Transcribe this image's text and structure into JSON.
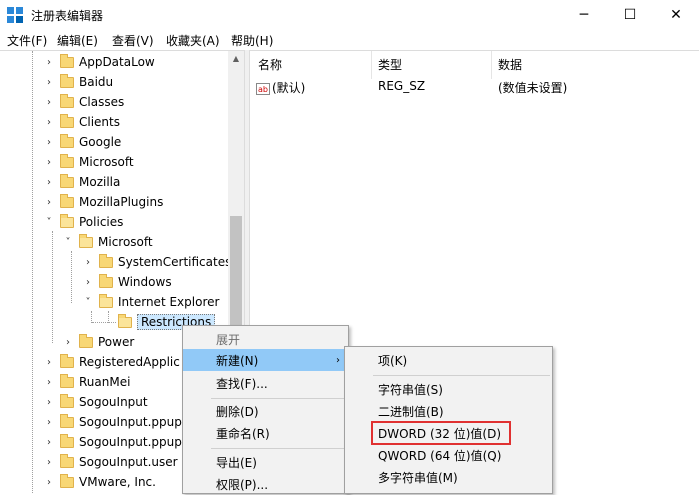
{
  "window": {
    "title": "注册表编辑器",
    "minimize": "─",
    "maximize": "☐",
    "close": "✕"
  },
  "menubar": [
    "文件(F)",
    "编辑(E)",
    "查看(V)",
    "收藏夹(A)",
    "帮助(H)"
  ],
  "tree": [
    {
      "label": "AppDataLow",
      "chevron": "›"
    },
    {
      "label": "Baidu",
      "chevron": "›"
    },
    {
      "label": "Classes",
      "chevron": "›"
    },
    {
      "label": "Clients",
      "chevron": "›"
    },
    {
      "label": "Google",
      "chevron": "›"
    },
    {
      "label": "Microsoft",
      "chevron": "›"
    },
    {
      "label": "Mozilla",
      "chevron": "›"
    },
    {
      "label": "MozillaPlugins",
      "chevron": "›"
    },
    {
      "label": "Policies",
      "chevron": "˅"
    },
    {
      "label": "Microsoft",
      "chevron": "˅"
    },
    {
      "label": "SystemCertificates",
      "chevron": "›"
    },
    {
      "label": "Windows",
      "chevron": "›"
    },
    {
      "label": "Internet Explorer",
      "chevron": "˅"
    },
    {
      "label": "Restrictions",
      "chevron": ""
    },
    {
      "label": "Power",
      "chevron": "›"
    },
    {
      "label": "RegisteredApplic",
      "chevron": "›"
    },
    {
      "label": "RuanMei",
      "chevron": "›"
    },
    {
      "label": "SogouInput",
      "chevron": "›"
    },
    {
      "label": "SogouInput.ppup",
      "chevron": "›"
    },
    {
      "label": "SogouInput.ppup",
      "chevron": "›"
    },
    {
      "label": "SogouInput.user",
      "chevron": "›"
    },
    {
      "label": "VMware, Inc.",
      "chevron": "›"
    }
  ],
  "list": {
    "headers": {
      "name": "名称",
      "type": "类型",
      "data": "数据"
    },
    "rows": [
      {
        "name": "(默认)",
        "type": "REG_SZ",
        "data": "(数值未设置)",
        "icon_text": "ab"
      }
    ]
  },
  "context_menu": {
    "items": [
      "展开",
      "新建(N)",
      "查找(F)...",
      "删除(D)",
      "重命名(R)",
      "导出(E)",
      "权限(P)..."
    ],
    "submenu_arrow": "›"
  },
  "submenu": {
    "items": [
      "项(K)",
      "字符串值(S)",
      "二进制值(B)",
      "DWORD (32 位)值(D)",
      "QWORD (64 位)值(Q)",
      "多字符串值(M)"
    ]
  },
  "colors": {
    "highlight": "#91c9f7",
    "selection": "#cce8ff",
    "annotation_box": "#e03131",
    "folder": "#f8d775"
  }
}
